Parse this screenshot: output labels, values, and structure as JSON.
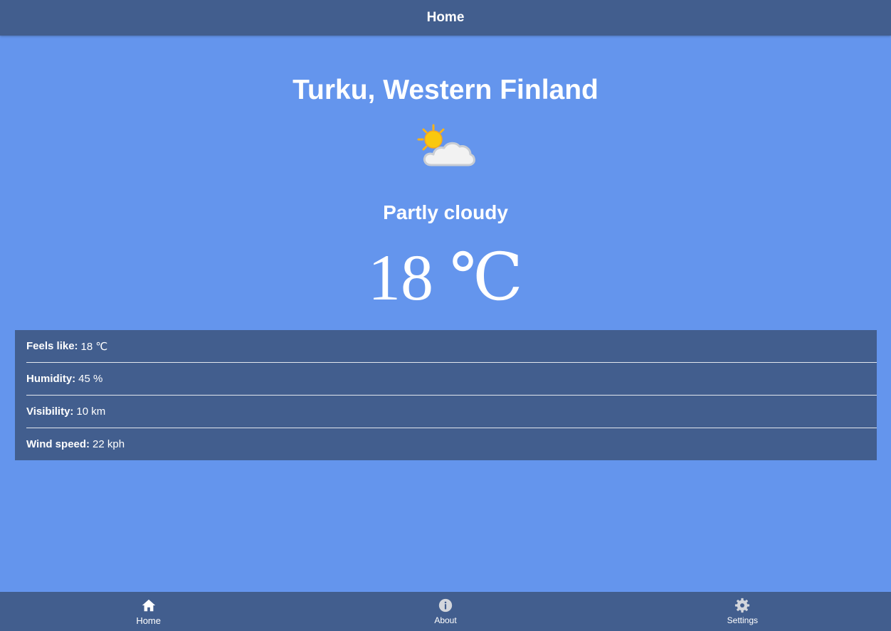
{
  "header": {
    "title": "Home"
  },
  "weather": {
    "location": "Turku, Western Finland",
    "icon": "partly-cloudy-icon",
    "condition": "Partly cloudy",
    "temperature": "18 ℃"
  },
  "details": [
    {
      "label": "Feels like:",
      "value": "18 ℃"
    },
    {
      "label": "Humidity:",
      "value": "45 %"
    },
    {
      "label": "Visibility:",
      "value": "10 km"
    },
    {
      "label": "Wind speed:",
      "value": "22 kph"
    }
  ],
  "nav": {
    "items": [
      {
        "label": "Home",
        "icon": "home-icon"
      },
      {
        "label": "About",
        "icon": "info-icon"
      },
      {
        "label": "Settings",
        "icon": "gear-icon"
      }
    ]
  },
  "colors": {
    "background": "#6495ed",
    "bar": "#425e8e",
    "text": "#ffffff",
    "sun": "#f9c80e"
  }
}
